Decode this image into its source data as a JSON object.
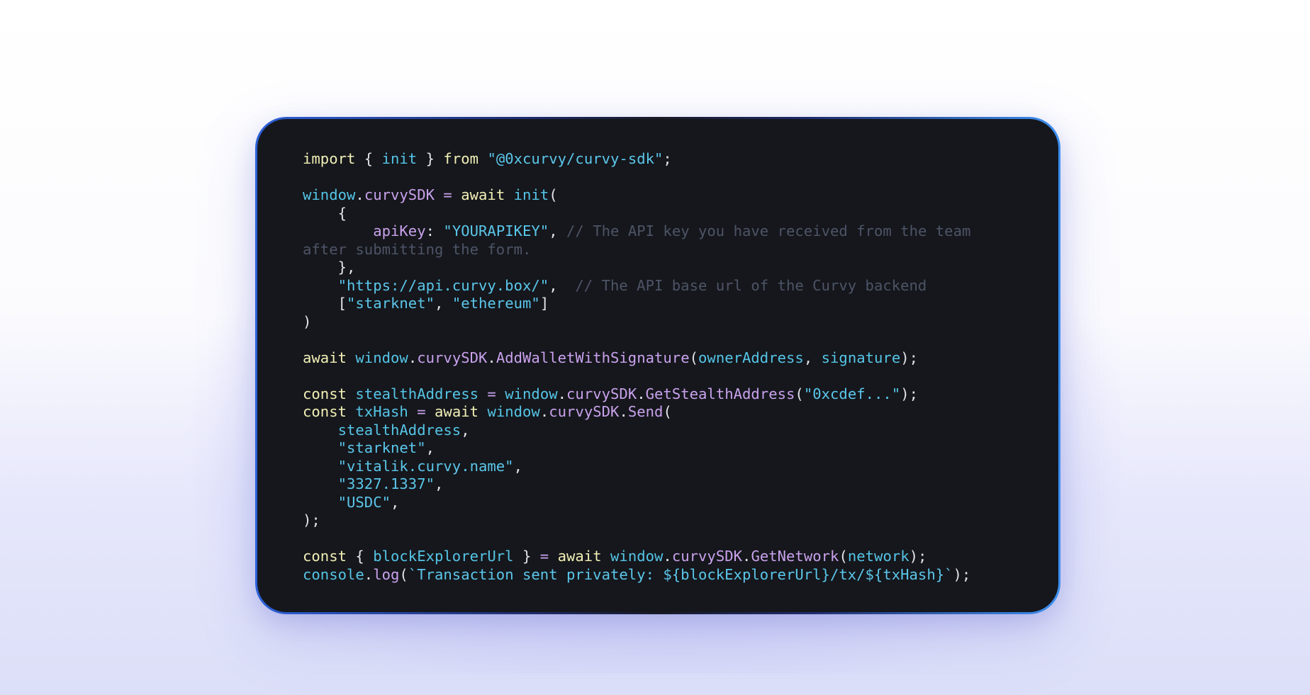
{
  "code_lines": [
    [
      [
        "kw",
        "import"
      ],
      [
        "pun",
        " { "
      ],
      [
        "var",
        "init"
      ],
      [
        "pun",
        " } "
      ],
      [
        "kw",
        "from"
      ],
      [
        "pun",
        " "
      ],
      [
        "str",
        "\"@0xcurvy/curvy-sdk\""
      ],
      [
        "pun",
        ";"
      ]
    ],
    [],
    [
      [
        "var",
        "window"
      ],
      [
        "pun",
        "."
      ],
      [
        "prop",
        "curvySDK"
      ],
      [
        "pun",
        " "
      ],
      [
        "op",
        "="
      ],
      [
        "pun",
        " "
      ],
      [
        "kw",
        "await"
      ],
      [
        "pun",
        " "
      ],
      [
        "var",
        "init"
      ],
      [
        "pun",
        "("
      ]
    ],
    [
      [
        "pun",
        "    {"
      ]
    ],
    [
      [
        "pun",
        "        "
      ],
      [
        "prop",
        "apiKey"
      ],
      [
        "pun",
        ": "
      ],
      [
        "str",
        "\"YOURAPIKEY\""
      ],
      [
        "pun",
        ", "
      ],
      [
        "cmt",
        "// The API key you have received from the team"
      ]
    ],
    [
      [
        "cmt",
        "after submitting the form."
      ]
    ],
    [
      [
        "pun",
        "    },"
      ]
    ],
    [
      [
        "pun",
        "    "
      ],
      [
        "str",
        "\"https://api.curvy.box/\""
      ],
      [
        "pun",
        ",  "
      ],
      [
        "cmt",
        "// The API base url of the Curvy backend"
      ]
    ],
    [
      [
        "pun",
        "    ["
      ],
      [
        "str",
        "\"starknet\""
      ],
      [
        "pun",
        ", "
      ],
      [
        "str",
        "\"ethereum\""
      ],
      [
        "pun",
        "]"
      ]
    ],
    [
      [
        "pun",
        ")"
      ]
    ],
    [],
    [
      [
        "kw",
        "await"
      ],
      [
        "pun",
        " "
      ],
      [
        "var",
        "window"
      ],
      [
        "pun",
        "."
      ],
      [
        "prop",
        "curvySDK"
      ],
      [
        "pun",
        "."
      ],
      [
        "prop",
        "AddWalletWithSignature"
      ],
      [
        "pun",
        "("
      ],
      [
        "var",
        "ownerAddress"
      ],
      [
        "pun",
        ", "
      ],
      [
        "var",
        "signature"
      ],
      [
        "pun",
        ");"
      ]
    ],
    [],
    [
      [
        "kw",
        "const"
      ],
      [
        "pun",
        " "
      ],
      [
        "var",
        "stealthAddress"
      ],
      [
        "pun",
        " "
      ],
      [
        "op",
        "="
      ],
      [
        "pun",
        " "
      ],
      [
        "var",
        "window"
      ],
      [
        "pun",
        "."
      ],
      [
        "prop",
        "curvySDK"
      ],
      [
        "pun",
        "."
      ],
      [
        "prop",
        "GetStealthAddress"
      ],
      [
        "pun",
        "("
      ],
      [
        "str",
        "\"0xcdef...\""
      ],
      [
        "pun",
        ");"
      ]
    ],
    [
      [
        "kw",
        "const"
      ],
      [
        "pun",
        " "
      ],
      [
        "var",
        "txHash"
      ],
      [
        "pun",
        " "
      ],
      [
        "op",
        "="
      ],
      [
        "pun",
        " "
      ],
      [
        "kw",
        "await"
      ],
      [
        "pun",
        " "
      ],
      [
        "var",
        "window"
      ],
      [
        "pun",
        "."
      ],
      [
        "prop",
        "curvySDK"
      ],
      [
        "pun",
        "."
      ],
      [
        "prop",
        "Send"
      ],
      [
        "pun",
        "("
      ]
    ],
    [
      [
        "pun",
        "    "
      ],
      [
        "var",
        "stealthAddress"
      ],
      [
        "pun",
        ","
      ]
    ],
    [
      [
        "pun",
        "    "
      ],
      [
        "str",
        "\"starknet\""
      ],
      [
        "pun",
        ","
      ]
    ],
    [
      [
        "pun",
        "    "
      ],
      [
        "str",
        "\"vitalik.curvy.name\""
      ],
      [
        "pun",
        ","
      ]
    ],
    [
      [
        "pun",
        "    "
      ],
      [
        "str",
        "\"3327.1337\""
      ],
      [
        "pun",
        ","
      ]
    ],
    [
      [
        "pun",
        "    "
      ],
      [
        "str",
        "\"USDC\""
      ],
      [
        "pun",
        ","
      ]
    ],
    [
      [
        "pun",
        ");"
      ]
    ],
    [],
    [
      [
        "kw",
        "const"
      ],
      [
        "pun",
        " { "
      ],
      [
        "var",
        "blockExplorerUrl"
      ],
      [
        "pun",
        " } "
      ],
      [
        "op",
        "="
      ],
      [
        "pun",
        " "
      ],
      [
        "kw",
        "await"
      ],
      [
        "pun",
        " "
      ],
      [
        "var",
        "window"
      ],
      [
        "pun",
        "."
      ],
      [
        "prop",
        "curvySDK"
      ],
      [
        "pun",
        "."
      ],
      [
        "prop",
        "GetNetwork"
      ],
      [
        "pun",
        "("
      ],
      [
        "var",
        "network"
      ],
      [
        "pun",
        ");"
      ]
    ],
    [
      [
        "var",
        "console"
      ],
      [
        "pun",
        "."
      ],
      [
        "prop",
        "log"
      ],
      [
        "pun",
        "("
      ],
      [
        "str",
        "`Transaction sent privately: ${blockExplorerUrl}/tx/${txHash}`"
      ],
      [
        "pun",
        ");"
      ]
    ]
  ]
}
